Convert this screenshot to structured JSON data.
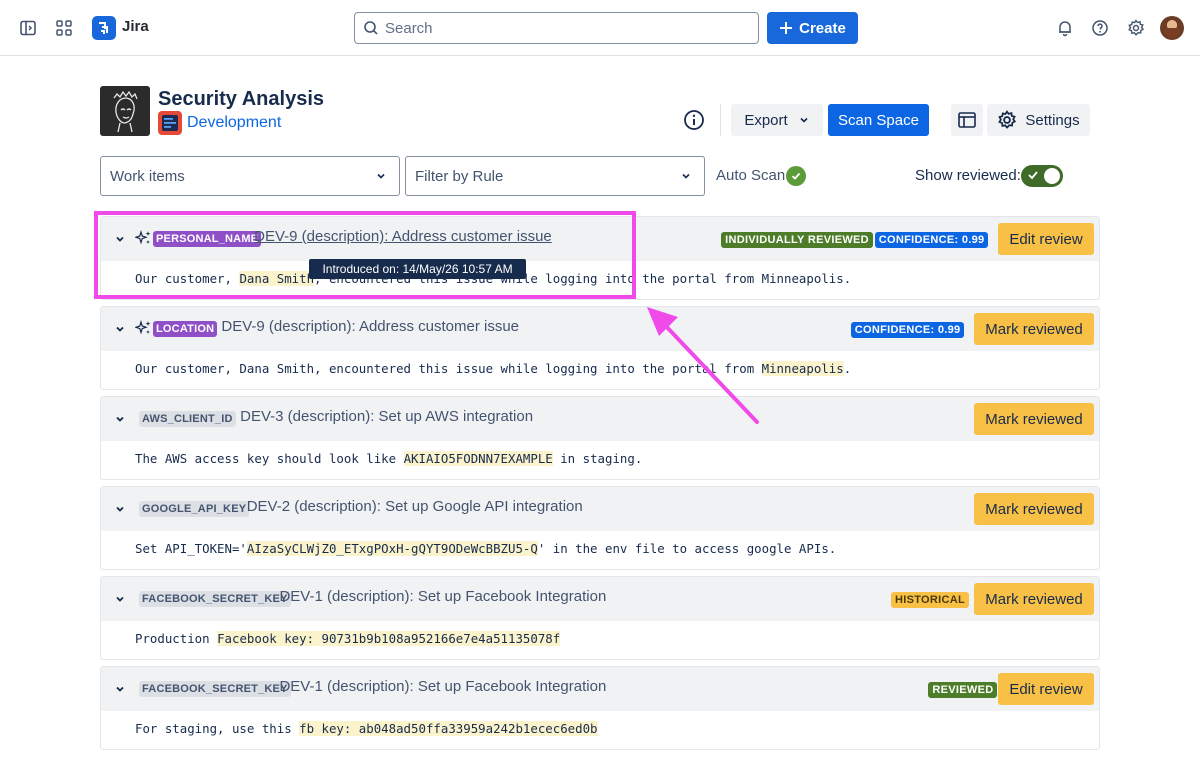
{
  "nav": {
    "app_name": "Jira",
    "search_placeholder": "Search",
    "create_label": "Create"
  },
  "header": {
    "title": "Security Analysis",
    "space_name": "Development",
    "export_label": "Export",
    "scan_label": "Scan Space",
    "settings_label": "Settings"
  },
  "filters": {
    "work_items": "Work items",
    "rule": "Filter by Rule",
    "auto_scan": "Auto Scan",
    "show_reviewed": "Show reviewed:",
    "show_reviewed_on": true
  },
  "tooltip": "Introduced on:  14/May/26 10:57 AM",
  "findings": [
    {
      "rule": "PERSONAL_NAME",
      "title": "DEV-9 (description): Address customer issue",
      "badges": [
        "INDIVIDUALLY REVIEWED",
        "CONFIDENCE: 0.99"
      ],
      "action": "Edit review",
      "text_before": "Our customer, ",
      "text_match": "Dana Smith",
      "text_after": ", encountered this issue while logging into the portal from Minneapolis."
    },
    {
      "rule": "LOCATION",
      "title": "DEV-9 (description): Address customer issue",
      "badges": [
        "CONFIDENCE: 0.99"
      ],
      "action": "Mark reviewed",
      "text_before": "Our customer, Dana Smith, encountered this issue while logging into the portal from ",
      "text_match": "Minneapolis",
      "text_after": "."
    },
    {
      "rule": "AWS_CLIENT_ID",
      "title": "DEV-3 (description): Set up AWS integration",
      "badges": [],
      "action": "Mark reviewed",
      "text_before": "The AWS access key should look like ",
      "text_match": "AKIAIO5FODNN7EXAMPLE",
      "text_after": " in staging."
    },
    {
      "rule": "GOOGLE_API_KEY",
      "title": "DEV-2 (description): Set up Google API integration",
      "badges": [],
      "action": "Mark reviewed",
      "text_before": "Set API_TOKEN='",
      "text_match": "AIzaSyCLWjZ0_ETxgPOxH-gQYT9ODeWcBBZU5-Q",
      "text_after": "' in the env file to access google APIs."
    },
    {
      "rule": "FACEBOOK_SECRET_KEY",
      "title": "DEV-1 (description): Set up Facebook Integration",
      "badges": [
        "HISTORICAL"
      ],
      "action": "Mark reviewed",
      "text_before": "Production ",
      "text_match": "Facebook key: 90731b9b108a952166e7e4a51135078f",
      "text_after": ""
    },
    {
      "rule": "FACEBOOK_SECRET_KEY",
      "title": "DEV-1 (description): Set up Facebook Integration",
      "badges": [
        "REVIEWED"
      ],
      "action": "Edit review",
      "text_before": "For staging, use this ",
      "text_match": "fb key: ab048ad50ffa33959a242b1ecec6ed0b",
      "text_after": ""
    }
  ],
  "colors": {
    "brand_blue": "#0c66e4",
    "review_yellow": "#f8c045",
    "reviewed_green": "#4e7d2a",
    "annotation_magenta": "#f04be8"
  }
}
